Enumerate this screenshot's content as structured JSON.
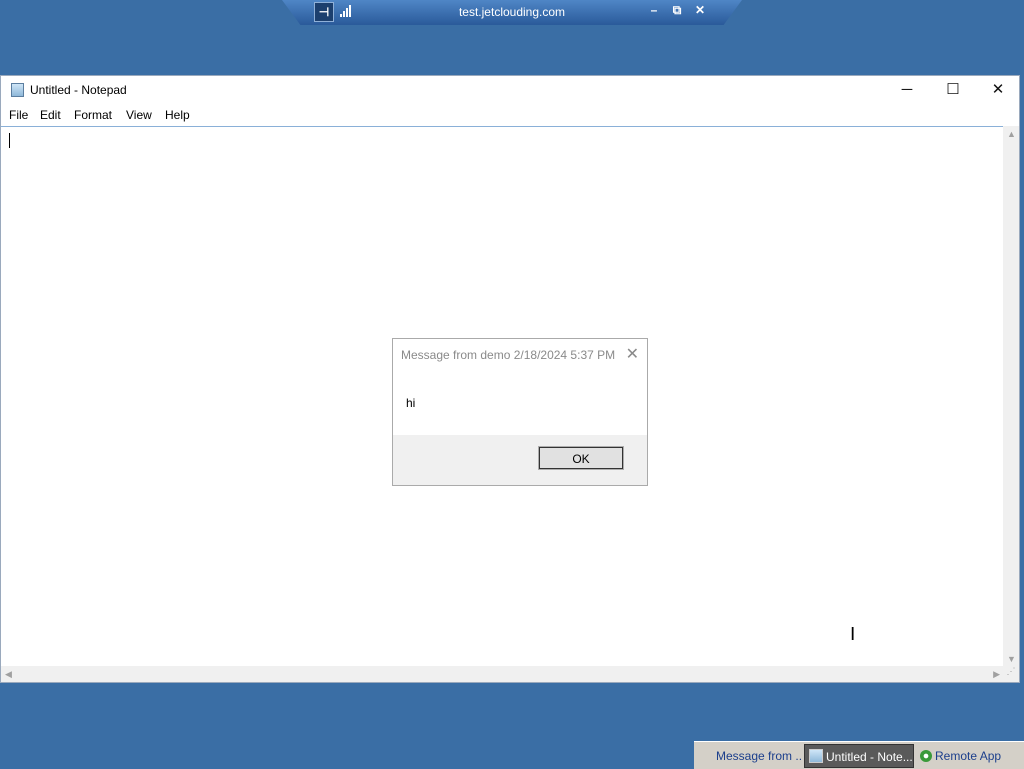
{
  "rdp_bar": {
    "title": "test.jetclouding.com",
    "pin_glyph": "⊣",
    "minimize_glyph": "–",
    "restore_glyph": "⧉",
    "close_glyph": "✕"
  },
  "notepad": {
    "title": "Untitled - Notepad",
    "minimize_glyph": "─",
    "maximize_glyph": "☐",
    "close_glyph": "✕",
    "menu": [
      "File",
      "Edit",
      "Format",
      "View",
      "Help"
    ],
    "content": ""
  },
  "message_box": {
    "title": "Message from demo 2/18/2024 5:37 PM",
    "close_glyph": "✕",
    "text": "hi",
    "ok_label": "OK"
  },
  "taskbar": {
    "items": [
      {
        "label": "Message from ...",
        "active": false,
        "icon": "message-icon"
      },
      {
        "label": "Untitled - Note...",
        "active": true,
        "icon": "notepad-icon"
      },
      {
        "label": "Remote App",
        "active": false,
        "icon": "remote-app-icon"
      }
    ]
  },
  "colors": {
    "desktop": "#3a6ea5",
    "rdp_bar": "#2a5a9a",
    "taskbar": "#d4d0c8",
    "active_task": "#5a5a5a"
  }
}
